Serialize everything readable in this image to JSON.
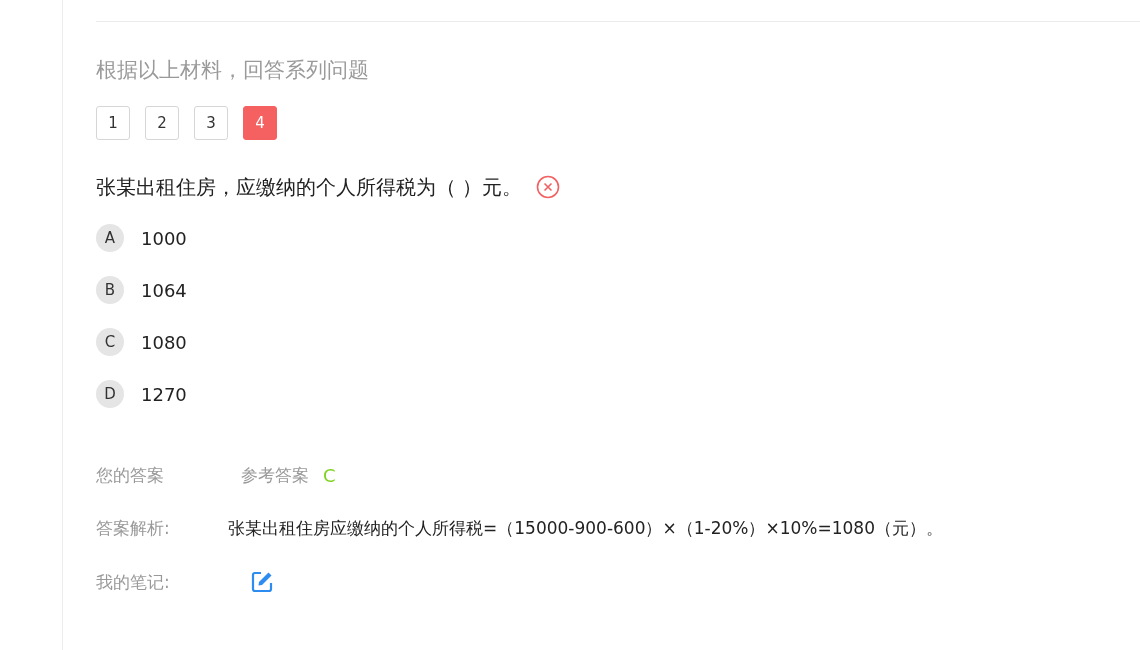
{
  "prompt": "根据以上材料，回答系列问题",
  "question_tabs": [
    {
      "label": "1",
      "selected": false
    },
    {
      "label": "2",
      "selected": false
    },
    {
      "label": "3",
      "selected": false
    },
    {
      "label": "4",
      "selected": true
    }
  ],
  "question": {
    "text": "张某出租住房，应缴纳的个人所得税为（ ）元。",
    "wrong": true
  },
  "options": [
    {
      "letter": "A",
      "text": "1000"
    },
    {
      "letter": "B",
      "text": "1064"
    },
    {
      "letter": "C",
      "text": "1080"
    },
    {
      "letter": "D",
      "text": "1270"
    }
  ],
  "your_answer_label": "您的答案",
  "reference_label": "参考答案",
  "reference_value": "C",
  "analysis_label": "答案解析:",
  "analysis_text": "张某出租住房应缴纳的个人所得税=（15000-900-600）×（1-20%）×10%=1080（元）。",
  "notes_label": "我的笔记:"
}
